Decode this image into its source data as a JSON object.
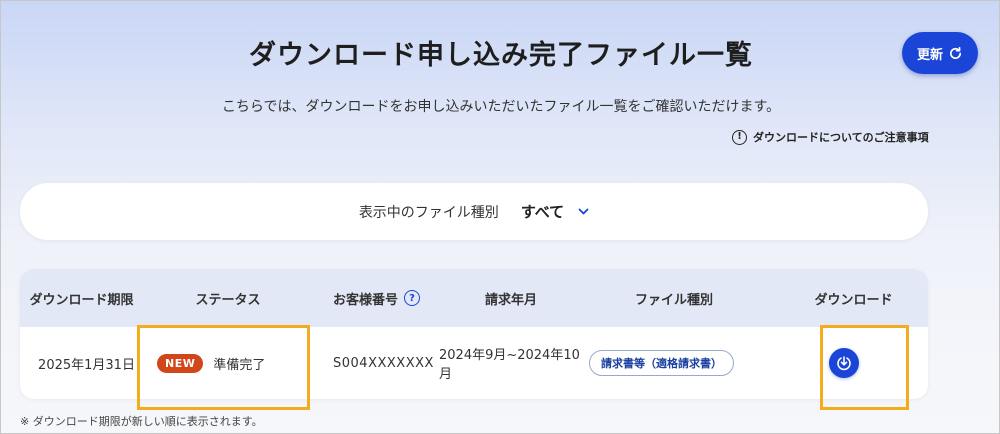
{
  "header": {
    "title": "ダウンロード申し込み完了ファイル一覧",
    "refresh_label": "更新",
    "subtitle": "こちらでは、ダウンロードをお申し込みいただいたファイル一覧をご確認いただけます。",
    "notice_link": "ダウンロードについてのご注意事項",
    "notice_icon_text": "!"
  },
  "filter": {
    "label": "表示中のファイル種別",
    "value": "すべて"
  },
  "table": {
    "columns": [
      "ダウンロード期限",
      "ステータス",
      "お客様番号",
      "請求年月",
      "ファイル種別",
      "ダウンロード"
    ],
    "help_icon_text": "?",
    "rows": [
      {
        "deadline": "2025年1月31日",
        "badge": "NEW",
        "status": "準備完了",
        "customer_no": "S004XXXXXXX",
        "period": "2024年9月~2024年10月",
        "file_type": "請求書等（適格請求書）"
      }
    ]
  },
  "footnote": "※ ダウンロード期限が新しい順に表示されます。",
  "colors": {
    "accent": "#1b45d6",
    "badge_new": "#d2471a",
    "highlight": "#f3ac1d"
  }
}
